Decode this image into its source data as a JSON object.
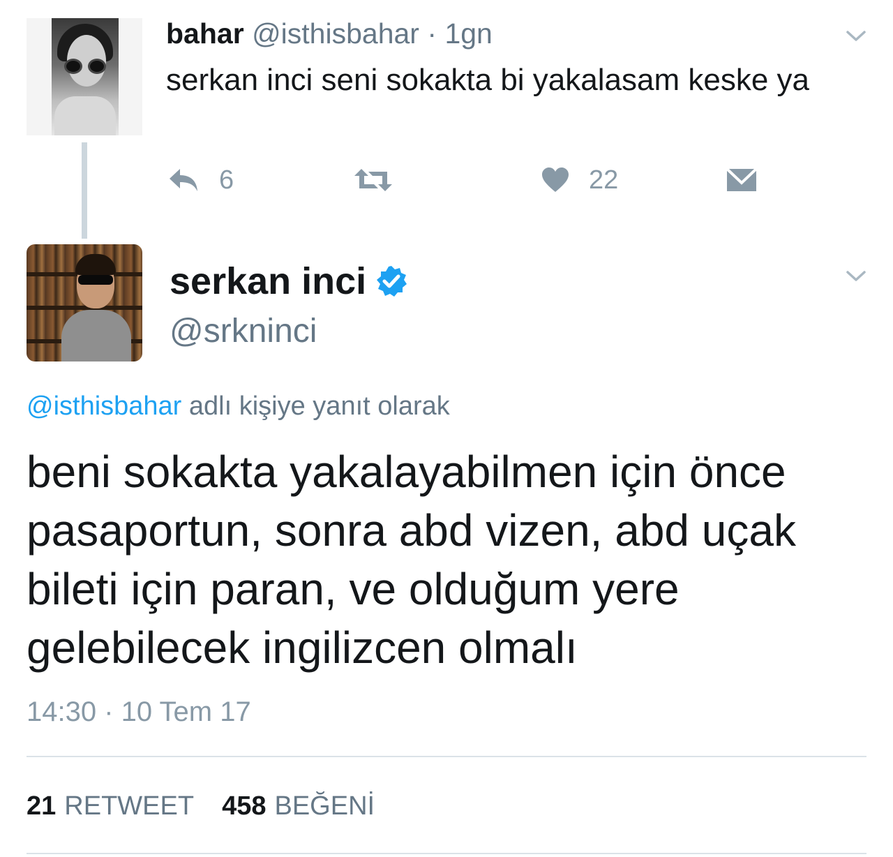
{
  "parent_tweet": {
    "name": "bahar",
    "handle": "@isthisbahar",
    "separator": "·",
    "time": "1gn",
    "text": "serkan inci seni sokakta bi yakalasam keske ya",
    "actions": {
      "reply_count": "6",
      "like_count": "22"
    }
  },
  "main_tweet": {
    "name": "serkan inci",
    "handle": "@srkninci",
    "reply_to_handle": "@isthisbahar",
    "reply_to_suffix": "adlı kişiye yanıt olarak",
    "text": "beni sokakta yakalayabilmen için önce pasaportun, sonra abd vizen, abd uçak bileti için paran, ve olduğum yere gelebilecek ingilizcen olmalı",
    "timestamp": "14:30 · 10 Tem 17",
    "stats": {
      "retweet_count": "21",
      "retweet_label": "RETWEET",
      "like_count": "458",
      "like_label": "BEĞENİ"
    }
  },
  "icons": {
    "reply": "reply-icon",
    "retweet": "retweet-icon",
    "like": "heart-icon",
    "dm": "envelope-icon",
    "caret": "chevron-down-icon",
    "verified": "verified-badge-icon"
  },
  "colors": {
    "text_primary": "#14171a",
    "text_muted": "#657786",
    "action_gray": "#8899a6",
    "link_blue": "#1da1f2",
    "verified_blue": "#1da1f2",
    "divider": "#dbe2e8"
  }
}
